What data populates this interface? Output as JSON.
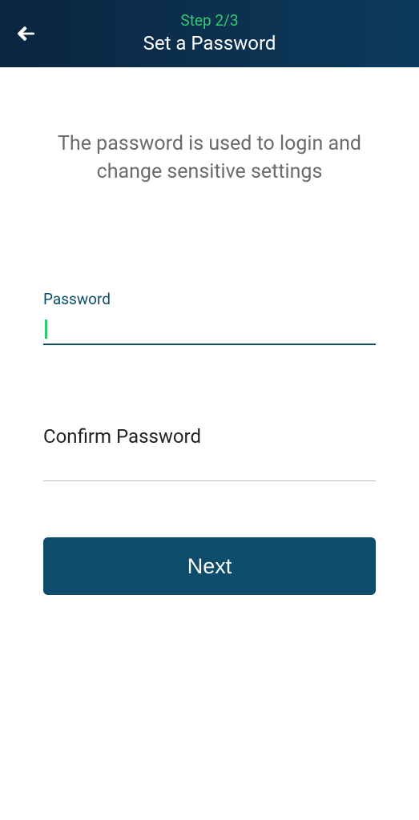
{
  "header": {
    "step_label": "Step 2/3",
    "title": "Set a Password"
  },
  "main": {
    "description": "The password is used to login and change sensitive settings",
    "password_label": "Password",
    "confirm_label": "Confirm Password",
    "next_button_label": "Next"
  }
}
